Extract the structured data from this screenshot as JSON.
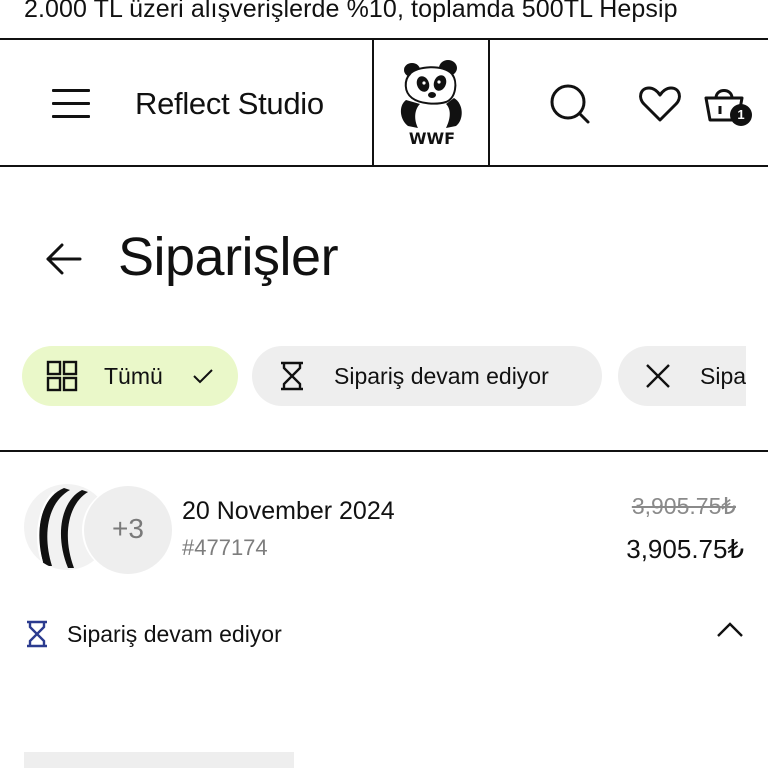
{
  "promo": {
    "text": "2.000 TL üzeri alışverişlerde %10, toplamda 500TL Hepsip"
  },
  "header": {
    "brand": "Reflect Studio",
    "logo_icon": "wwf-panda-logo",
    "search_icon": "search-icon",
    "wishlist_icon": "heart-icon",
    "cart_icon": "shopping-basket-icon",
    "cart_count": "1"
  },
  "page": {
    "title": "Siparişler",
    "back_icon": "arrow-left-icon"
  },
  "filters": [
    {
      "label": "Tümü",
      "icon": "grid-icon",
      "selected": true
    },
    {
      "label": "Sipariş devam ediyor",
      "icon": "hourglass-icon",
      "selected": false
    },
    {
      "label": "Sipa",
      "icon": "close-icon",
      "selected": false
    }
  ],
  "order": {
    "date": "20 November 2024",
    "number": "#477174",
    "extra_items": "+3",
    "original_price": "3,905.75₺",
    "price": "3,905.75₺",
    "status": "Sipariş devam ediyor",
    "status_icon": "hourglass-icon"
  },
  "colors": {
    "accent_chip": "#eaf8c9",
    "chip_bg": "#eeeeee",
    "status_icon": "#2b3b8f",
    "text": "#111111",
    "muted": "#7d7d7d"
  }
}
